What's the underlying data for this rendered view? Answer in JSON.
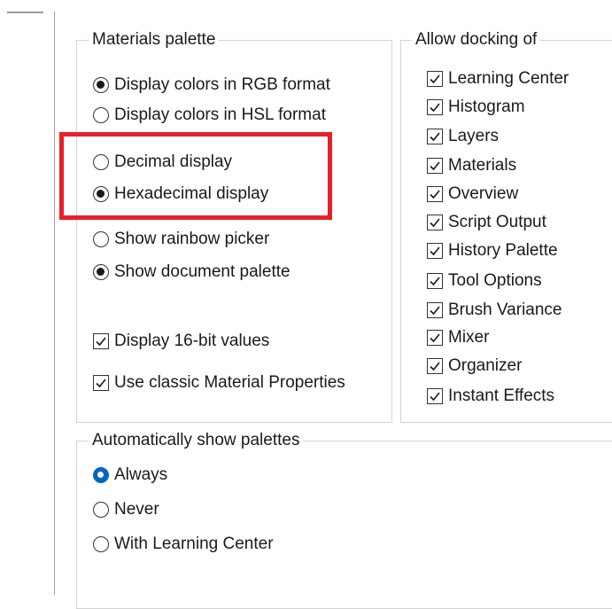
{
  "materials": {
    "title": "Materials palette",
    "color_format": [
      {
        "label": "Display colors in RGB format",
        "checked": true
      },
      {
        "label": "Display colors in HSL format",
        "checked": false
      }
    ],
    "number_display": [
      {
        "label": "Decimal display",
        "checked": false
      },
      {
        "label": "Hexadecimal display",
        "checked": true
      }
    ],
    "picker": [
      {
        "label": "Show rainbow picker",
        "checked": false
      },
      {
        "label": "Show document palette",
        "checked": true
      }
    ],
    "checkboxes": [
      {
        "label": "Display 16-bit values",
        "checked": true
      },
      {
        "label": "Use classic Material Properties",
        "checked": true
      }
    ]
  },
  "docking": {
    "title": "Allow docking of",
    "items": [
      {
        "label": "Learning Center",
        "checked": true
      },
      {
        "label": "Histogram",
        "checked": true
      },
      {
        "label": "Layers",
        "checked": true
      },
      {
        "label": "Materials",
        "checked": true
      },
      {
        "label": "Overview",
        "checked": true
      },
      {
        "label": "Script Output",
        "checked": true
      },
      {
        "label": "History Palette",
        "checked": true
      },
      {
        "label": "Tool Options",
        "checked": true
      },
      {
        "label": "Brush Variance",
        "checked": true
      },
      {
        "label": "Mixer",
        "checked": true
      },
      {
        "label": "Organizer",
        "checked": true
      },
      {
        "label": "Instant Effects",
        "checked": true
      }
    ]
  },
  "auto_show": {
    "title": "Automatically show palettes",
    "options": [
      {
        "label": "Always",
        "checked": true
      },
      {
        "label": "Never",
        "checked": false
      },
      {
        "label": "With Learning Center",
        "checked": false
      }
    ]
  },
  "colors": {
    "highlight": "#e8202a",
    "accent": "#0067c0",
    "group_border": "#d4d4d4"
  }
}
